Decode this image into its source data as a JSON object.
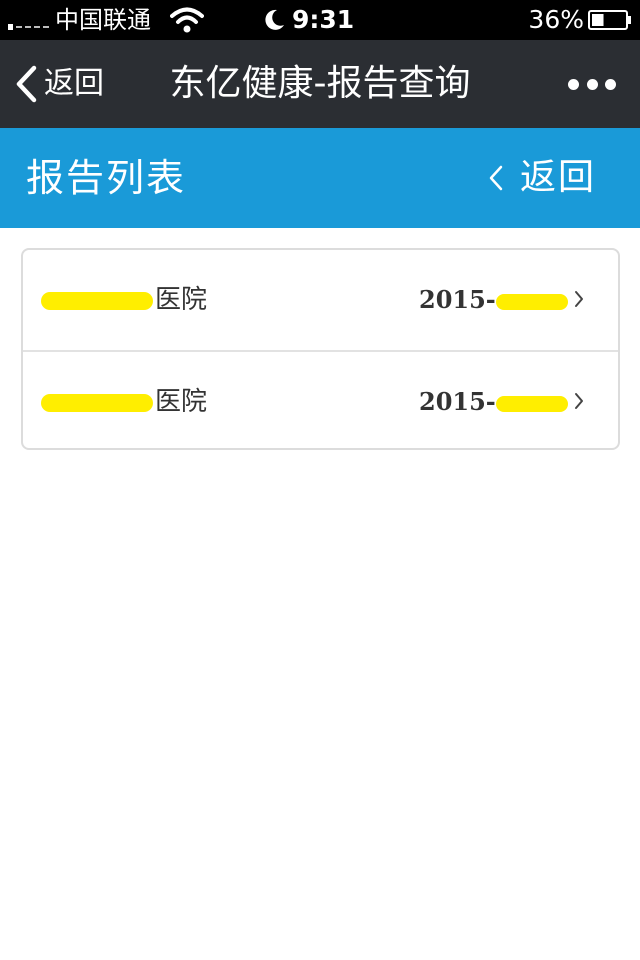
{
  "status_bar": {
    "carrier": "中国联通",
    "time": "9:31",
    "battery": "36%",
    "battery_level": 0.36
  },
  "nav": {
    "back_label": "返回",
    "title": "东亿健康-报告查询",
    "more_icon": "more-dots-icon"
  },
  "header": {
    "title": "报告列表",
    "back_label": "返回",
    "color": "#1a9ad8"
  },
  "reports": [
    {
      "hospital_suffix": "医院",
      "date_prefix": "2015-"
    },
    {
      "hospital_suffix": "医院",
      "date_prefix": "2015-"
    }
  ],
  "colors": {
    "nav_bg": "#2b2e33",
    "accent": "#1a9ad8",
    "redaction": "#ffee00"
  }
}
